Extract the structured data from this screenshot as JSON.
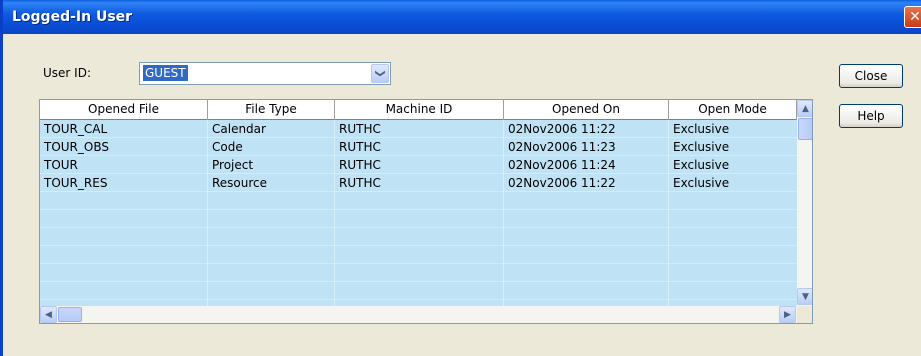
{
  "window": {
    "title": "Logged-In User",
    "close_glyph": "✕"
  },
  "user": {
    "label": "User ID:",
    "value": "GUEST",
    "dropdown_glyph": "❯"
  },
  "buttons": {
    "close": "Close",
    "help": "Help"
  },
  "table": {
    "columns": [
      "Opened File",
      "File Type",
      "Machine ID",
      "Opened On",
      "Open Mode"
    ],
    "rows": [
      [
        "TOUR_CAL",
        "Calendar",
        "RUTHC",
        "02Nov2006 11:22",
        "Exclusive"
      ],
      [
        "TOUR_OBS",
        "Code",
        "RUTHC",
        "02Nov2006 11:23",
        "Exclusive"
      ],
      [
        "TOUR",
        "Project",
        "RUTHC",
        "02Nov2006 11:24",
        "Exclusive"
      ],
      [
        "TOUR_RES",
        "Resource",
        "RUTHC",
        "02Nov2006 11:22",
        "Exclusive"
      ]
    ]
  },
  "scrollbar": {
    "up": "▲",
    "down": "▼",
    "left": "◀",
    "right": "▶"
  },
  "colors": {
    "title_bar": "#0a4fd8",
    "grid_row": "#bfe2f5",
    "selection": "#316ac5"
  }
}
